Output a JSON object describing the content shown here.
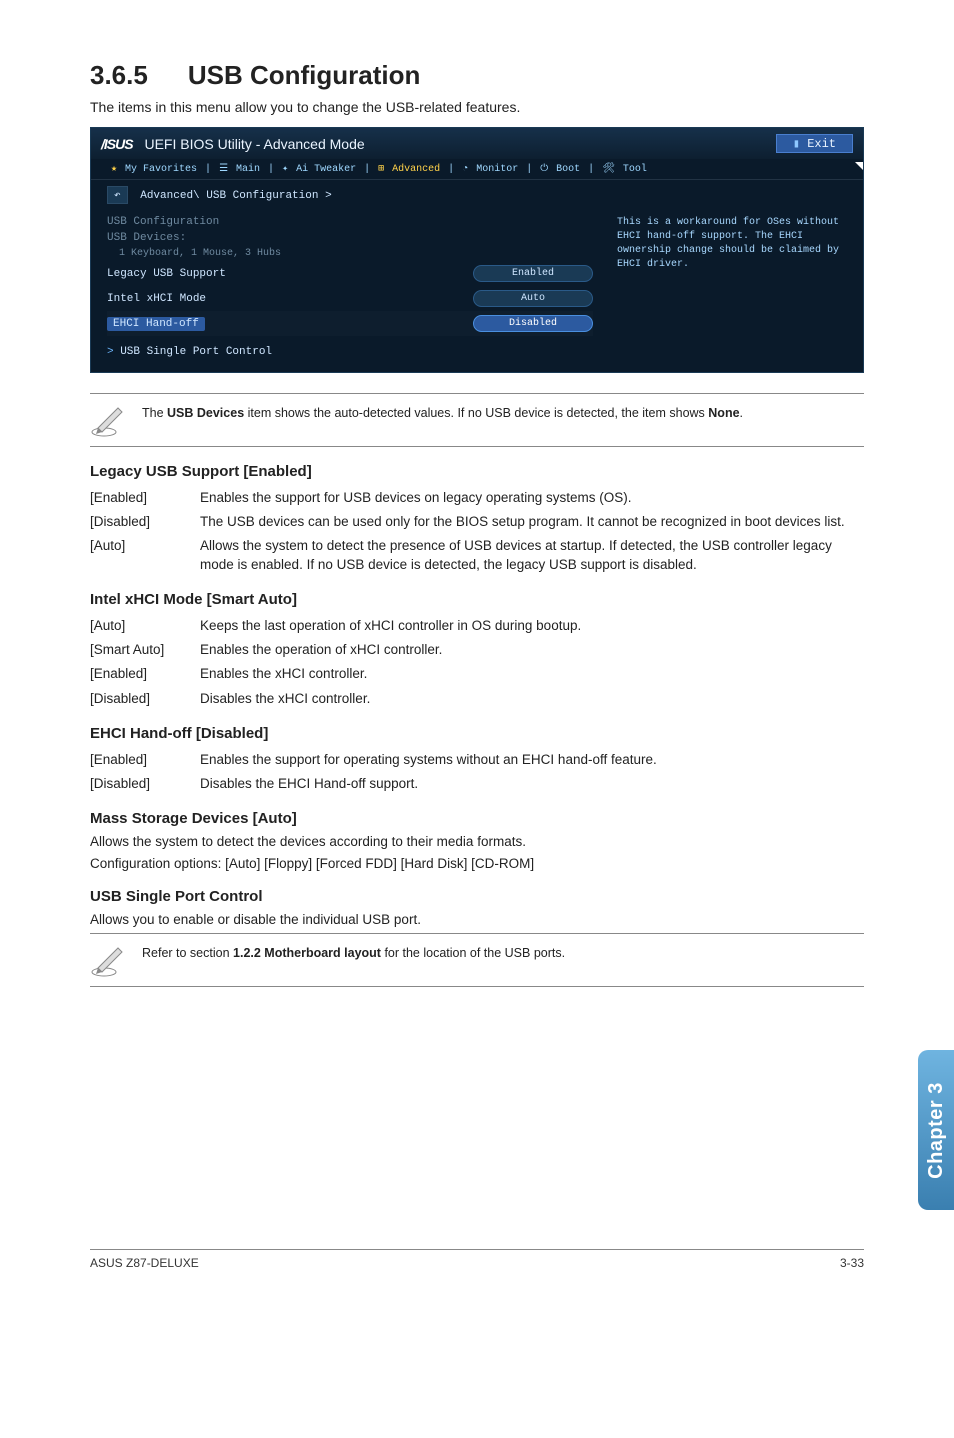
{
  "section": {
    "number": "3.6.5",
    "title": "USB Configuration"
  },
  "intro": "The items in this menu allow you to change the USB-related features.",
  "bios": {
    "logo": "/ISUS",
    "title": "UEFI BIOS Utility - Advanced Mode",
    "exit": "Exit",
    "tabs": {
      "favorites": "My Favorites",
      "main": "Main",
      "ai": "Ai Tweaker",
      "advanced": "Advanced",
      "monitor": "Monitor",
      "boot": "Boot",
      "tool": "Tool"
    },
    "breadcrumb": "Advanced\\ USB Configuration >",
    "section_title": "USB Configuration",
    "devices_label": "USB Devices:",
    "devices_value": "1 Keyboard, 1 Mouse, 3 Hubs",
    "rows": {
      "legacy": {
        "label": "Legacy USB Support",
        "value": "Enabled"
      },
      "xhci": {
        "label": "Intel xHCI Mode",
        "value": "Auto"
      },
      "ehci": {
        "label": "EHCI Hand-off",
        "value": "Disabled"
      }
    },
    "single_port": "USB Single Port Control",
    "help": "This is a workaround for OSes without EHCI hand-off support. The EHCI ownership change should be claimed by EHCI driver."
  },
  "note_usb_devices": {
    "pre": "The ",
    "bold1": "USB Devices",
    "mid": " item shows the auto-detected values. If no USB device is detected, the item shows ",
    "bold2": "None",
    "post": "."
  },
  "legacy": {
    "heading": "Legacy USB Support [Enabled]",
    "opts": [
      {
        "k": "[Enabled]",
        "v": "Enables the support for USB devices on legacy operating systems (OS)."
      },
      {
        "k": "[Disabled]",
        "v": "The USB devices can be used only for the BIOS setup program. It cannot be recognized in boot devices list."
      },
      {
        "k": "[Auto]",
        "v": "Allows the system to detect the presence of USB devices at startup. If detected, the USB controller legacy mode is enabled. If no USB device is detected, the legacy USB support is disabled."
      }
    ]
  },
  "xhci": {
    "heading": "Intel xHCI Mode [Smart Auto]",
    "opts": [
      {
        "k": "[Auto]",
        "v": "Keeps the last operation of xHCI controller in OS during bootup."
      },
      {
        "k": "[Smart Auto]",
        "v": "Enables the operation of xHCI controller."
      },
      {
        "k": "[Enabled]",
        "v": "Enables the xHCI controller."
      },
      {
        "k": "[Disabled]",
        "v": "Disables the xHCI controller."
      }
    ]
  },
  "ehci": {
    "heading": "EHCI Hand-off [Disabled]",
    "opts": [
      {
        "k": "[Enabled]",
        "v": "Enables the support for operating systems without an EHCI hand-off feature."
      },
      {
        "k": "[Disabled]",
        "v": "Disables the EHCI Hand-off support."
      }
    ]
  },
  "mass": {
    "heading": "Mass Storage Devices [Auto]",
    "line1": "Allows the system to detect the devices according to their media formats.",
    "line2": "Configuration options: [Auto] [Floppy] [Forced FDD] [Hard Disk] [CD-ROM]"
  },
  "singleport": {
    "heading": "USB Single Port Control",
    "line": "Allows you to enable or disable the individual USB port."
  },
  "note_ports": {
    "pre": "Refer to section ",
    "bold": "1.2.2 Motherboard layout",
    "post": " for the location of the USB ports."
  },
  "chapter_tab": "Chapter 3",
  "footer": {
    "left": "ASUS Z87-DELUXE",
    "right": "3-33"
  }
}
